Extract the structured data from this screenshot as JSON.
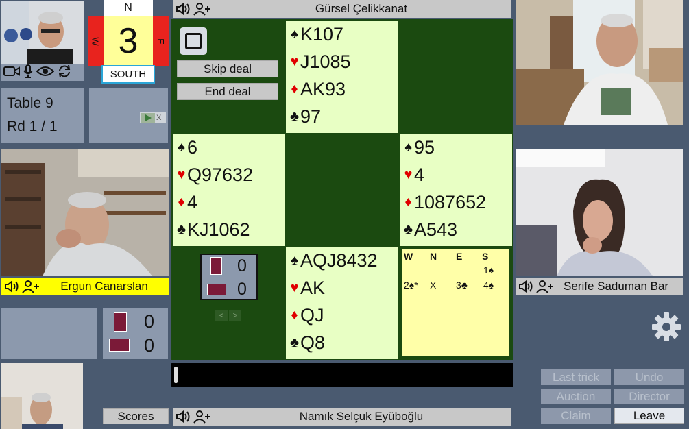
{
  "compass": {
    "north": "N",
    "south": "SOUTH",
    "west": "W",
    "east": "E",
    "board_number": "3"
  },
  "table": {
    "name": "Table 9",
    "round": "Rd 1 / 1"
  },
  "ad": {
    "icon": "play-icon",
    "close": "X"
  },
  "players": {
    "north": "Gürsel Çelikkanat",
    "west": "Ergun Canarslan",
    "east": "Serife Saduman Bar",
    "south": "Namık Selçuk Eyüboğlu"
  },
  "deal_controls": {
    "skip": "Skip deal",
    "end": "End deal"
  },
  "hands": {
    "north": {
      "spades": "K107",
      "hearts": "J1085",
      "diamonds": "AK93",
      "clubs": "97"
    },
    "west": {
      "spades": "6",
      "hearts": "Q97632",
      "diamonds": "4",
      "clubs": "KJ1062"
    },
    "east": {
      "spades": "95",
      "hearts": "4",
      "diamonds": "1087652",
      "clubs": "A543"
    },
    "south": {
      "spades": "AQJ8432",
      "hearts": "AK",
      "diamonds": "QJ",
      "clubs": "Q8"
    }
  },
  "suit_symbols": {
    "spades": "♠",
    "hearts": "♥",
    "diamonds": "♦",
    "clubs": "♣"
  },
  "bidding": {
    "headers": [
      "W",
      "N",
      "E",
      "S"
    ],
    "row1": {
      "s_level": "1",
      "s_suit": "♠"
    },
    "row2": {
      "w_level": "2",
      "w_suit": "♠",
      "w_alert": "*",
      "n": "X",
      "e_level": "3",
      "e_suit": "♣",
      "s_level": "4",
      "s_suit": "♠"
    }
  },
  "tricks_center": {
    "ns": "0",
    "ew": "0"
  },
  "tricks_left": {
    "ns": "0",
    "ew": "0"
  },
  "buttons": {
    "scores": "Scores",
    "last_trick": "Last trick",
    "undo": "Undo",
    "auction": "Auction",
    "director": "Director",
    "claim": "Claim",
    "leave": "Leave"
  },
  "colors": {
    "table_green": "#1b4a10",
    "card_cell": "#e8ffc4",
    "name_highlight": "#ffff00",
    "board_yellow": "#ffff99",
    "vul_red": "#e8231e"
  }
}
